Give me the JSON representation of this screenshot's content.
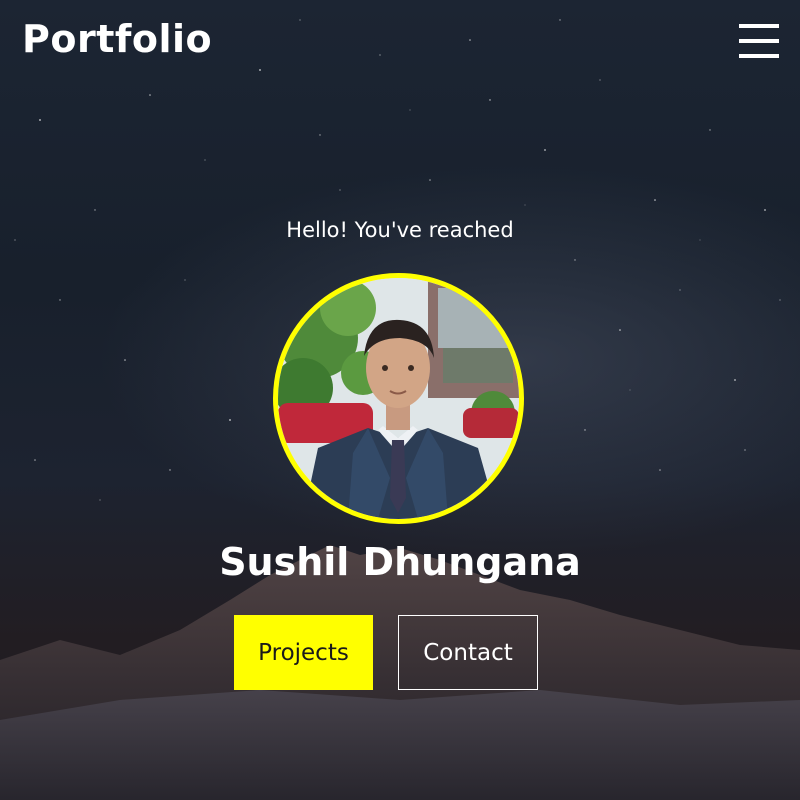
{
  "header": {
    "brand": "Portfolio",
    "menu_icon": "hamburger-menu-icon"
  },
  "hero": {
    "greeting": "Hello! You've reached",
    "name": "Sushil Dhungana",
    "avatar": "profile-photo"
  },
  "actions": {
    "projects_label": "Projects",
    "contact_label": "Contact"
  },
  "colors": {
    "accent": "#ffff00",
    "text": "#ffffff",
    "background": "#1a2230"
  }
}
